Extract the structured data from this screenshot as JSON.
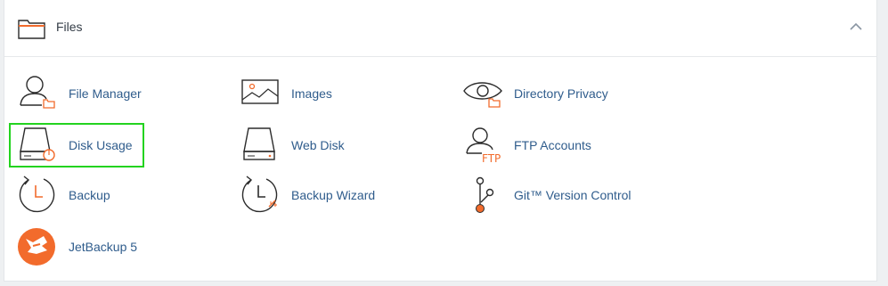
{
  "section": {
    "title": "Files",
    "icon": "folder-icon",
    "collapse_icon": "chevron-up-icon"
  },
  "items": [
    {
      "label": "File Manager",
      "icon": "file-manager-icon"
    },
    {
      "label": "Images",
      "icon": "images-icon"
    },
    {
      "label": "Directory Privacy",
      "icon": "directory-privacy-icon"
    },
    {
      "label": "Disk Usage",
      "icon": "disk-usage-icon",
      "highlighted": true
    },
    {
      "label": "Web Disk",
      "icon": "web-disk-icon"
    },
    {
      "label": "FTP Accounts",
      "icon": "ftp-accounts-icon",
      "icon_text": "FTP"
    },
    {
      "label": "Backup",
      "icon": "backup-icon"
    },
    {
      "label": "Backup Wizard",
      "icon": "backup-wizard-icon"
    },
    {
      "label": "Git™ Version Control",
      "icon": "git-version-control-icon"
    },
    {
      "label": "JetBackup 5",
      "icon": "jetbackup-icon"
    }
  ],
  "colors": {
    "accent": "#f26b2c",
    "link": "#2f5c8c",
    "highlight": "#23d31f",
    "icon_stroke": "#2b2b2b"
  }
}
